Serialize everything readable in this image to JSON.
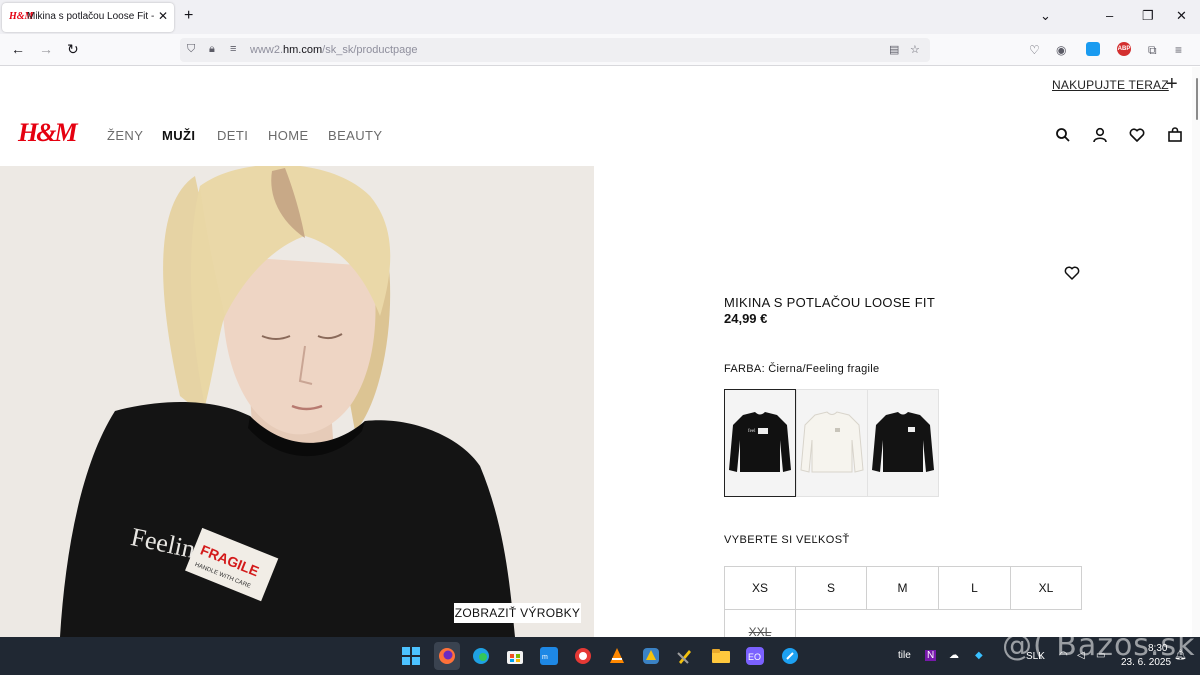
{
  "browser": {
    "tab_title": "Mikina s potlačou Loose Fit - Čierna/Feeling fragile - MUŽI | H&M SK",
    "tab_favicon_text": "H&M",
    "url_prefix": "www2.",
    "url_domain": "hm.com",
    "url_path": "/sk_sk/productpage"
  },
  "header": {
    "shop_now": "NAKUPUJTE TERAZ",
    "logo": "H&M",
    "menu": [
      "ŽENY",
      "MUŽI",
      "DETI",
      "HOME",
      "BEAUTY"
    ],
    "active_menu": "MUŽI"
  },
  "hero": {
    "show_products": "ZOBRAZIŤ VÝROBKY",
    "print_word": "Feeling",
    "label_word": "FRAGILE",
    "label_sub": "HANDLE WITH CARE"
  },
  "product": {
    "name": "MIKINA S POTLAČOU LOOSE FIT",
    "price": "24,99 €",
    "color_label": "FARBA: Čierna/Feeling fragile",
    "swatches": [
      {
        "name": "Čierna/Feeling fragile",
        "color": "#111111",
        "selected": true
      },
      {
        "name": "Biela",
        "color": "#f2f0ea",
        "selected": false
      },
      {
        "name": "Čierna",
        "color": "#131313",
        "selected": false
      }
    ],
    "size_heading": "VYBERTE SI VEĽKOSŤ",
    "sizes": [
      "XS",
      "S",
      "M",
      "L",
      "XL",
      "XXL"
    ],
    "out_of_stock": [
      "XXL"
    ]
  },
  "taskbar": {
    "tray_lang": "SLK",
    "time": "8:30",
    "date": "23. 6. 2025",
    "tile_text": "tile"
  },
  "watermark": "@( Bazos.sk"
}
